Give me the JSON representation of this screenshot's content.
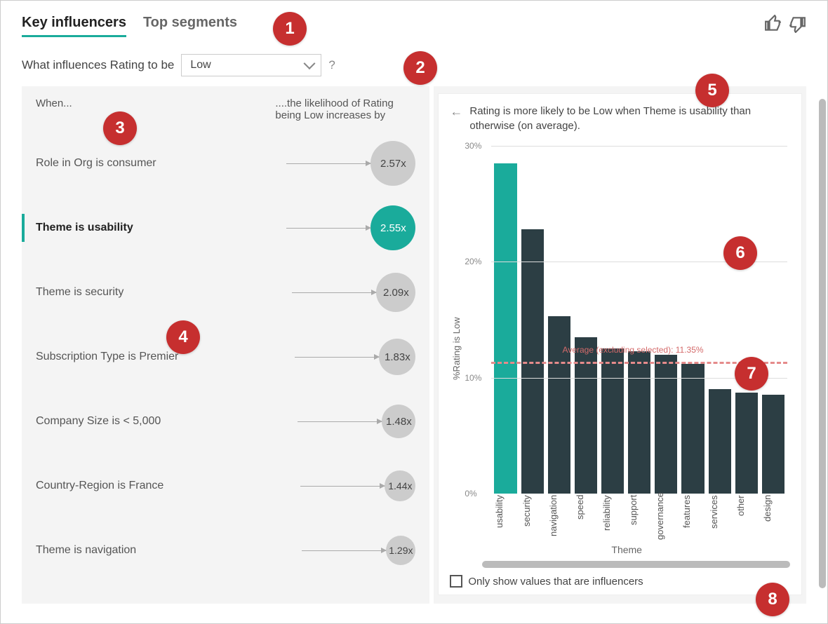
{
  "header": {
    "tab_key_influencers": "Key influencers",
    "tab_top_segments": "Top segments"
  },
  "question": {
    "prefix": "What influences Rating to be",
    "selected_value": "Low",
    "help": "?"
  },
  "columns": {
    "when": "When...",
    "likelihood": "....the likelihood of Rating being Low increases by"
  },
  "influencers": [
    {
      "label": "Role in Org is consumer",
      "value": "2.57x",
      "selected": false
    },
    {
      "label": "Theme is usability",
      "value": "2.55x",
      "selected": true
    },
    {
      "label": "Theme is security",
      "value": "2.09x",
      "selected": false
    },
    {
      "label": "Subscription Type is Premier",
      "value": "1.83x",
      "selected": false
    },
    {
      "label": "Company Size is < 5,000",
      "value": "1.48x",
      "selected": false
    },
    {
      "label": "Country-Region is France",
      "value": "1.44x",
      "selected": false
    },
    {
      "label": "Theme is navigation",
      "value": "1.29x",
      "selected": false
    }
  ],
  "detail": {
    "insight": "Rating is more likely to be Low when Theme is usability than otherwise (on average).",
    "checkbox_label": "Only show values that are influencers"
  },
  "chart_data": {
    "type": "bar",
    "ylabel": "%Rating is Low",
    "xlabel": "Theme",
    "ylim": [
      0,
      30
    ],
    "ticks": [
      0,
      10,
      20,
      30
    ],
    "avg_label": "Average (excluding selected): 11.35%",
    "avg_value": 11.35,
    "categories": [
      "usability",
      "security",
      "navigation",
      "speed",
      "reliability",
      "support",
      "governance",
      "features",
      "services",
      "other",
      "design"
    ],
    "values": [
      28.5,
      22.8,
      15.3,
      13.5,
      12.5,
      12.3,
      12.0,
      11.2,
      9.0,
      8.7,
      8.5
    ],
    "highlight": "usability"
  },
  "callouts": [
    "1",
    "2",
    "3",
    "4",
    "5",
    "6",
    "7",
    "8"
  ]
}
